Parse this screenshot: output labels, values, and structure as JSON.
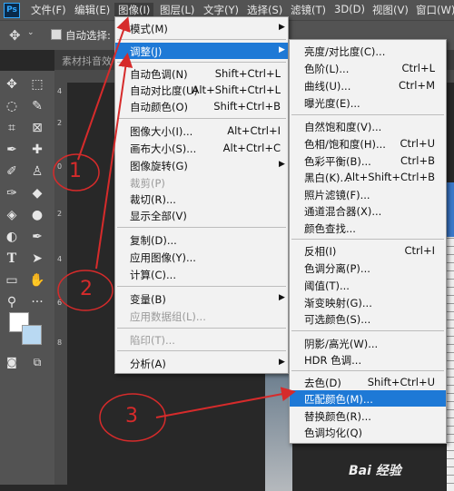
{
  "menubar": {
    "logo": "Ps",
    "items": [
      "文件(F)",
      "编辑(E)",
      "图像(I)",
      "图层(L)",
      "文字(Y)",
      "选择(S)",
      "滤镜(T)",
      "3D(D)",
      "视图(V)",
      "窗口(W)"
    ]
  },
  "options": {
    "auto_select_label": "自动选择:"
  },
  "document_tab": {
    "title": "素材抖音效"
  },
  "ruler": {
    "left_numbers": [
      "4",
      "2",
      "0",
      "2",
      "4",
      "6",
      "8"
    ]
  },
  "image_menu": {
    "items": [
      {
        "label": "模式(M)",
        "shortcut": "",
        "submenu": true
      },
      {
        "label": "调整(J)",
        "shortcut": "",
        "submenu": true,
        "highlighted": true
      },
      {
        "label": "自动色调(N)",
        "shortcut": "Shift+Ctrl+L"
      },
      {
        "label": "自动对比度(U)",
        "shortcut": "Alt+Shift+Ctrl+L"
      },
      {
        "label": "自动颜色(O)",
        "shortcut": "Shift+Ctrl+B"
      },
      {
        "label": "图像大小(I)...",
        "shortcut": "Alt+Ctrl+I"
      },
      {
        "label": "画布大小(S)...",
        "shortcut": "Alt+Ctrl+C"
      },
      {
        "label": "图像旋转(G)",
        "shortcut": "",
        "submenu": true
      },
      {
        "label": "裁剪(P)",
        "shortcut": "",
        "disabled": true
      },
      {
        "label": "裁切(R)...",
        "shortcut": ""
      },
      {
        "label": "显示全部(V)",
        "shortcut": ""
      },
      {
        "label": "复制(D)...",
        "shortcut": ""
      },
      {
        "label": "应用图像(Y)...",
        "shortcut": ""
      },
      {
        "label": "计算(C)...",
        "shortcut": ""
      },
      {
        "label": "变量(B)",
        "shortcut": "",
        "submenu": true
      },
      {
        "label": "应用数据组(L)...",
        "shortcut": "",
        "disabled": true
      },
      {
        "label": "陷印(T)...",
        "shortcut": "",
        "disabled": true
      },
      {
        "label": "分析(A)",
        "shortcut": "",
        "submenu": true
      }
    ]
  },
  "adjust_menu": {
    "items": [
      {
        "label": "亮度/对比度(C)...",
        "shortcut": ""
      },
      {
        "label": "色阶(L)...",
        "shortcut": "Ctrl+L"
      },
      {
        "label": "曲线(U)...",
        "shortcut": "Ctrl+M"
      },
      {
        "label": "曝光度(E)...",
        "shortcut": ""
      },
      {
        "label": "自然饱和度(V)...",
        "shortcut": ""
      },
      {
        "label": "色相/饱和度(H)...",
        "shortcut": "Ctrl+U"
      },
      {
        "label": "色彩平衡(B)...",
        "shortcut": "Ctrl+B"
      },
      {
        "label": "黑白(K)...",
        "shortcut": "Alt+Shift+Ctrl+B"
      },
      {
        "label": "照片滤镜(F)...",
        "shortcut": ""
      },
      {
        "label": "通道混合器(X)...",
        "shortcut": ""
      },
      {
        "label": "颜色查找...",
        "shortcut": ""
      },
      {
        "label": "反相(I)",
        "shortcut": "Ctrl+I"
      },
      {
        "label": "色调分离(P)...",
        "shortcut": ""
      },
      {
        "label": "阈值(T)...",
        "shortcut": ""
      },
      {
        "label": "渐变映射(G)...",
        "shortcut": ""
      },
      {
        "label": "可选颜色(S)...",
        "shortcut": ""
      },
      {
        "label": "阴影/高光(W)...",
        "shortcut": ""
      },
      {
        "label": "HDR 色调...",
        "shortcut": ""
      },
      {
        "label": "去色(D)",
        "shortcut": "Shift+Ctrl+U"
      },
      {
        "label": "匹配颜色(M)...",
        "shortcut": "",
        "highlighted": true
      },
      {
        "label": "替换颜色(R)...",
        "shortcut": ""
      },
      {
        "label": "色调均化(Q)",
        "shortcut": ""
      }
    ]
  },
  "annotations": {
    "n1": "1",
    "n2": "2",
    "n3": "3",
    "color": "#d62b2b"
  },
  "watermark": {
    "text": "Bai 经验"
  }
}
